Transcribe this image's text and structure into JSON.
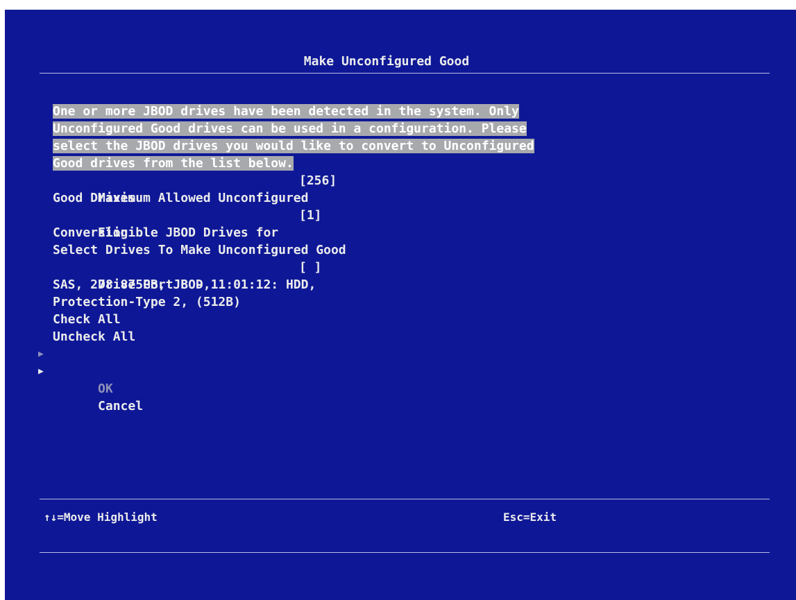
{
  "title": "Make Unconfigured Good",
  "description_lines": [
    "One or more JBOD drives have been detected in the system. Only",
    "Unconfigured Good drives can be used in a configuration. Please",
    "select the JBOD drives you would like to convert to Unconfigured",
    "Good drives from the list below."
  ],
  "max_allowed": {
    "label_line1": "Maximum Allowed Unconfigured",
    "label_line2": "Good Drives",
    "value": "[256]"
  },
  "eligible": {
    "label_line1": "Eligible JBOD Drives for",
    "label_line2": "Conversion",
    "value": "[1]"
  },
  "select_heading": "Select Drives To Make Unconfigured Good",
  "drive": {
    "line1": "Drive Port 8 - 11:01:12: HDD,",
    "line2": "SAS, 278.875GB, JBOD,",
    "line3": "Protection-Type 2, (512B)",
    "checkbox": "[ ]"
  },
  "check_all": "Check All",
  "uncheck_all": "Uncheck All",
  "ok": "OK",
  "cancel": "Cancel",
  "arrow_glyph": "▶",
  "footer": {
    "left": "↑↓=Move Highlight",
    "right": "Esc=Exit"
  },
  "colors": {
    "background": "#0e1896",
    "text": "#ececec",
    "highlight": "#a7a9ad",
    "disabled": "#8e90b8"
  }
}
